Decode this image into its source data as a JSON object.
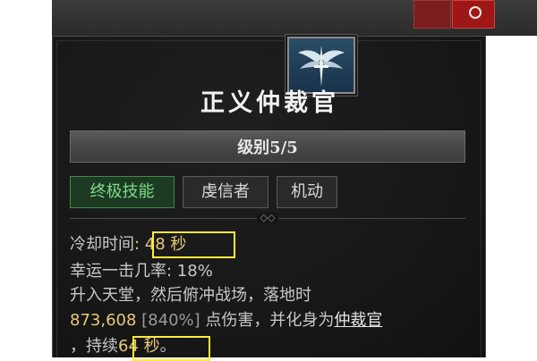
{
  "skill": {
    "icon": "angel-wings-sword-icon",
    "name": "正义仲裁官",
    "level": "级别5/5",
    "tags": [
      "终极技能",
      "虔信者",
      "机动"
    ]
  },
  "stats": {
    "cooldown_label": "冷却时间",
    "cooldown_value": ": 48 秒",
    "lucky_hit_label": "幸运一击几率",
    "lucky_hit_value": ": 18%"
  },
  "description": {
    "line1": "升入天堂，然后俯冲战场，落地时",
    "damage_value": "873,608",
    "damage_percent": " [840%]",
    "line2_text": " 点伤害，并化身为",
    "form_link": "仲裁官",
    "line3_prefix": "，持续",
    "duration_value": "64 秒",
    "line3_suffix": "。"
  },
  "colors": {
    "highlight_box": "#ffeb3b",
    "ultimate_tag": "#7fd98a",
    "value_gold": "#e8c97a"
  }
}
